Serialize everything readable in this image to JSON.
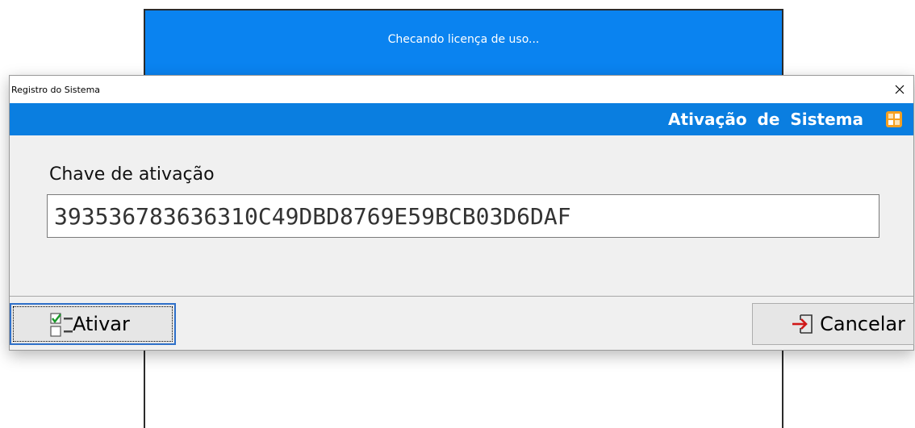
{
  "splash": {
    "status": "Checando licença de uso..."
  },
  "dialog": {
    "title": "Registro do Sistema",
    "header": "Ativação de Sistema",
    "field_label": "Chave de ativação",
    "activation_key": "393536783636310C49DBD8769E59BCB03D6DAF",
    "buttons": {
      "activate": "Ativar",
      "cancel": "Cancelar"
    }
  },
  "colors": {
    "accent": "#0a7ee0",
    "splash": "#0a83f0",
    "icon_orange": "#f5a020"
  },
  "icons": [
    "close-icon",
    "app-badge-icon",
    "checklist-icon",
    "exit-arrow-icon"
  ]
}
